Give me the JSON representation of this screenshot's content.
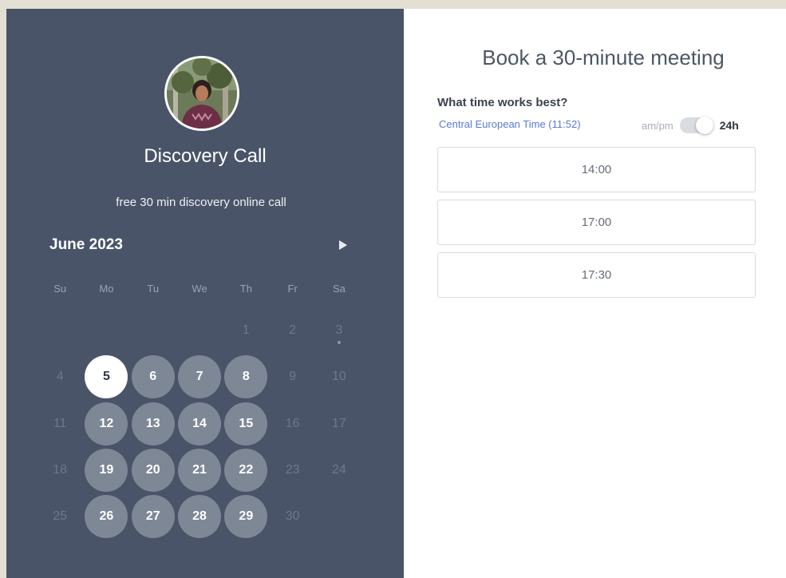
{
  "event": {
    "title": "Discovery Call",
    "description": "free 30 min discovery online call"
  },
  "calendar": {
    "month_label": "June 2023",
    "weekdays": [
      "Su",
      "Mo",
      "Tu",
      "We",
      "Th",
      "Fr",
      "Sa"
    ],
    "leading_blank_days": 4,
    "days": [
      {
        "num": "1",
        "state": "unavailable"
      },
      {
        "num": "2",
        "state": "unavailable"
      },
      {
        "num": "3",
        "state": "unavailable",
        "dot": true
      },
      {
        "num": "4",
        "state": "unavailable"
      },
      {
        "num": "5",
        "state": "selected"
      },
      {
        "num": "6",
        "state": "available"
      },
      {
        "num": "7",
        "state": "available"
      },
      {
        "num": "8",
        "state": "available"
      },
      {
        "num": "9",
        "state": "unavailable"
      },
      {
        "num": "10",
        "state": "unavailable"
      },
      {
        "num": "11",
        "state": "unavailable"
      },
      {
        "num": "12",
        "state": "available"
      },
      {
        "num": "13",
        "state": "available"
      },
      {
        "num": "14",
        "state": "available"
      },
      {
        "num": "15",
        "state": "available"
      },
      {
        "num": "16",
        "state": "unavailable"
      },
      {
        "num": "17",
        "state": "unavailable"
      },
      {
        "num": "18",
        "state": "unavailable"
      },
      {
        "num": "19",
        "state": "available"
      },
      {
        "num": "20",
        "state": "available"
      },
      {
        "num": "21",
        "state": "available"
      },
      {
        "num": "22",
        "state": "available"
      },
      {
        "num": "23",
        "state": "unavailable"
      },
      {
        "num": "24",
        "state": "unavailable"
      },
      {
        "num": "25",
        "state": "unavailable"
      },
      {
        "num": "26",
        "state": "available"
      },
      {
        "num": "27",
        "state": "available"
      },
      {
        "num": "28",
        "state": "available"
      },
      {
        "num": "29",
        "state": "available"
      },
      {
        "num": "30",
        "state": "unavailable"
      }
    ]
  },
  "booking": {
    "heading": "Book a 30-minute meeting",
    "question": "What time works best?",
    "timezone": "Central European Time (11:52)",
    "format_ampm": "am/pm",
    "format_24h": "24h",
    "format_selected": "24h",
    "slots": [
      "14:00",
      "17:00",
      "17:30"
    ]
  },
  "colors": {
    "left_panel": "#4a5468",
    "available_day": "#7e8796",
    "selected_day": "#ffffff",
    "link": "#5b78d6",
    "page_background": "#e3dfd2"
  },
  "icons": {
    "next_month": "triangle-right-icon"
  }
}
